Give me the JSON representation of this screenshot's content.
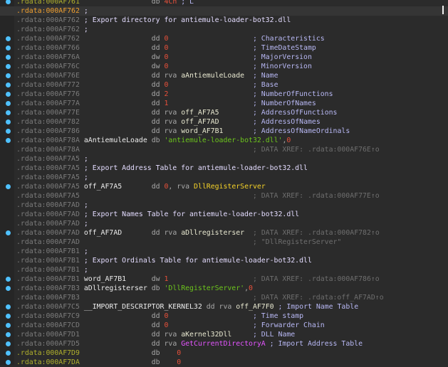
{
  "colors": {
    "background": "#2b2b2b",
    "address": "#7c7c7c",
    "address_undefined": "#b0b02c",
    "address_current": "#f0a030",
    "number": "#e8503a",
    "string": "#6cc41c",
    "comment": "#b8b8f4",
    "xref": "#6e6e6e",
    "export_func": "#f5d228",
    "import_func": "#e454ff",
    "breakpoint_dot": "#4fc1ff"
  },
  "lines": [
    {
      "addr": ".rdata:000AF761",
      "as": "olive",
      "dot": true,
      "mnem": "db",
      "ops": [
        {
          "t": "4Ch",
          "c": "num"
        }
      ],
      "icmt": "; L"
    },
    {
      "addr": ".rdata:000AF762",
      "as": "current",
      "bcmt": ";"
    },
    {
      "addr": ".rdata:000AF762",
      "bcmt": "; Export directory for antiemule-loader-bot32.dll"
    },
    {
      "addr": ".rdata:000AF762",
      "bcmt": ";"
    },
    {
      "addr": ".rdata:000AF762",
      "dot": true,
      "mnem": "dd",
      "ops": [
        {
          "t": "0",
          "c": "num"
        }
      ],
      "cmt": "; Characteristics"
    },
    {
      "addr": ".rdata:000AF766",
      "dot": true,
      "mnem": "dd",
      "ops": [
        {
          "t": "0",
          "c": "num"
        }
      ],
      "cmt": "; TimeDateStamp"
    },
    {
      "addr": ".rdata:000AF76A",
      "dot": true,
      "mnem": "dw",
      "ops": [
        {
          "t": "0",
          "c": "num"
        }
      ],
      "cmt": "; MajorVersion"
    },
    {
      "addr": ".rdata:000AF76C",
      "dot": true,
      "mnem": "dw",
      "ops": [
        {
          "t": "0",
          "c": "num"
        }
      ],
      "cmt": "; MinorVersion"
    },
    {
      "addr": ".rdata:000AF76E",
      "dot": true,
      "mnem": "dd",
      "ops": [
        {
          "t": "rva ",
          "c": "kw"
        },
        {
          "t": "aAntiemuleLoade",
          "c": "name"
        }
      ],
      "cmt": "; Name"
    },
    {
      "addr": ".rdata:000AF772",
      "dot": true,
      "mnem": "dd",
      "ops": [
        {
          "t": "0",
          "c": "num"
        }
      ],
      "cmt": "; Base"
    },
    {
      "addr": ".rdata:000AF776",
      "dot": true,
      "mnem": "dd",
      "ops": [
        {
          "t": "2",
          "c": "num"
        }
      ],
      "cmt": "; NumberOfFunctions"
    },
    {
      "addr": ".rdata:000AF77A",
      "dot": true,
      "mnem": "dd",
      "ops": [
        {
          "t": "1",
          "c": "num"
        }
      ],
      "cmt": "; NumberOfNames"
    },
    {
      "addr": ".rdata:000AF77E",
      "dot": true,
      "mnem": "dd",
      "ops": [
        {
          "t": "rva ",
          "c": "kw"
        },
        {
          "t": "off_AF7A5",
          "c": "name"
        }
      ],
      "cmt": "; AddressOfFunctions"
    },
    {
      "addr": ".rdata:000AF782",
      "dot": true,
      "mnem": "dd",
      "ops": [
        {
          "t": "rva ",
          "c": "kw"
        },
        {
          "t": "off_AF7AD",
          "c": "name"
        }
      ],
      "cmt": "; AddressOfNames"
    },
    {
      "addr": ".rdata:000AF786",
      "dot": true,
      "mnem": "dd",
      "ops": [
        {
          "t": "rva ",
          "c": "kw"
        },
        {
          "t": "word_AF7B1",
          "c": "name"
        }
      ],
      "cmt": "; AddressOfNameOrdinals"
    },
    {
      "addr": ".rdata:000AF78A",
      "dot": true,
      "label": "aAntiemuleLoade",
      "mnem": "db",
      "ops": [
        {
          "t": "'antiemule-loader-bot32.dll'",
          "c": "str"
        },
        {
          "t": ",",
          "c": "punct"
        },
        {
          "t": "0",
          "c": "num"
        }
      ]
    },
    {
      "addr": ".rdata:000AF78A",
      "xref": "; DATA XREF: .rdata:000AF76E↑o"
    },
    {
      "addr": ".rdata:000AF7A5",
      "bcmt": ";"
    },
    {
      "addr": ".rdata:000AF7A5",
      "bcmt": "; Export Address Table for antiemule-loader-bot32.dll"
    },
    {
      "addr": ".rdata:000AF7A5",
      "bcmt": ";"
    },
    {
      "addr": ".rdata:000AF7A5",
      "dot": true,
      "label": "off_AF7A5",
      "mnem": "dd",
      "ops": [
        {
          "t": "0",
          "c": "num"
        },
        {
          "t": ", rva ",
          "c": "kw"
        },
        {
          "t": "DllRegisterServer",
          "c": "func"
        }
      ]
    },
    {
      "addr": ".rdata:000AF7A5",
      "xref": "; DATA XREF: .rdata:000AF77E↑o"
    },
    {
      "addr": ".rdata:000AF7AD",
      "bcmt": ";"
    },
    {
      "addr": ".rdata:000AF7AD",
      "bcmt": "; Export Names Table for antiemule-loader-bot32.dll"
    },
    {
      "addr": ".rdata:000AF7AD",
      "bcmt": ";"
    },
    {
      "addr": ".rdata:000AF7AD",
      "dot": true,
      "label": "off_AF7AD",
      "mnem": "dd",
      "ops": [
        {
          "t": "rva ",
          "c": "kw"
        },
        {
          "t": "aDllregisterser",
          "c": "name"
        }
      ],
      "xref": "; DATA XREF: .rdata:000AF782↑o"
    },
    {
      "addr": ".rdata:000AF7AD",
      "xref": "; \"DllRegisterServer\""
    },
    {
      "addr": ".rdata:000AF7B1",
      "bcmt": ";"
    },
    {
      "addr": ".rdata:000AF7B1",
      "bcmt": "; Export Ordinals Table for antiemule-loader-bot32.dll"
    },
    {
      "addr": ".rdata:000AF7B1",
      "bcmt": ";"
    },
    {
      "addr": ".rdata:000AF7B1",
      "dot": true,
      "label": "word_AF7B1",
      "mnem": "dw",
      "ops": [
        {
          "t": "1",
          "c": "num"
        }
      ],
      "xref": "; DATA XREF: .rdata:000AF786↑o"
    },
    {
      "addr": ".rdata:000AF7B3",
      "dot": true,
      "label": "aDllregisterser",
      "mnem": "db",
      "ops": [
        {
          "t": "'DllRegisterServer'",
          "c": "str"
        },
        {
          "t": ",",
          "c": "punct"
        },
        {
          "t": "0",
          "c": "num"
        }
      ]
    },
    {
      "addr": ".rdata:000AF7B3",
      "xref": "; DATA XREF: .rdata:off_AF7AD↑o"
    },
    {
      "addr": ".rdata:000AF7C5",
      "dot": true,
      "label": "__IMPORT_DESCRIPTOR_KERNEL32",
      "mnem": "dd",
      "ops": [
        {
          "t": "rva ",
          "c": "kw"
        },
        {
          "t": "off_AF7F0",
          "c": "name"
        }
      ],
      "icmt": "; Import Name Table"
    },
    {
      "addr": ".rdata:000AF7C9",
      "dot": true,
      "mnem": "dd",
      "ops": [
        {
          "t": "0",
          "c": "num"
        }
      ],
      "cmt": "; Time stamp"
    },
    {
      "addr": ".rdata:000AF7CD",
      "dot": true,
      "mnem": "dd",
      "ops": [
        {
          "t": "0",
          "c": "num"
        }
      ],
      "cmt": "; Forwarder Chain"
    },
    {
      "addr": ".rdata:000AF7D1",
      "dot": true,
      "mnem": "dd",
      "ops": [
        {
          "t": "rva ",
          "c": "kw"
        },
        {
          "t": "aKernel32Dll",
          "c": "name"
        }
      ],
      "cmt": "; DLL Name"
    },
    {
      "addr": ".rdata:000AF7D5",
      "dot": true,
      "mnem": "dd",
      "ops": [
        {
          "t": "rva ",
          "c": "kw"
        },
        {
          "t": "GetCurrentDirectoryA",
          "c": "imp"
        }
      ],
      "icmt": "; Import Address Table"
    },
    {
      "addr": ".rdata:000AF7D9",
      "as": "olive",
      "dot": true,
      "mnem": "db",
      "ops": [
        {
          "t": "0",
          "c": "num"
        }
      ],
      "rj": true
    },
    {
      "addr": ".rdata:000AF7DA",
      "as": "olive",
      "dot": true,
      "mnem": "db",
      "ops": [
        {
          "t": "0",
          "c": "num"
        }
      ],
      "rj": true
    }
  ]
}
